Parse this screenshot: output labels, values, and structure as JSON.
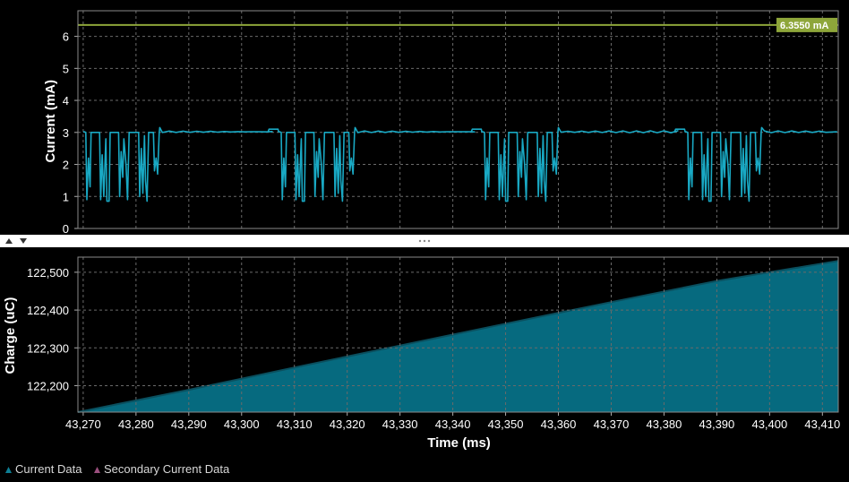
{
  "colors": {
    "background": "#000000",
    "current_series": "#19a9c4",
    "charge_fill": "#066a7f",
    "charge_edge": "#0a4f5e",
    "secondary_series": "#9b4f7e",
    "marker_line": "#8ea63a",
    "marker_badge": "#8ea63a",
    "splitter": "#ffffff",
    "grid": "#6a6a6a"
  },
  "splitter": {
    "up_arrow_icon": "triangle-up",
    "down_arrow_icon": "triangle-down",
    "grip_icon": "three-dots"
  },
  "legend": {
    "items": [
      {
        "label": "Current Data",
        "icon": "triangle-up",
        "color": "#0e7f95"
      },
      {
        "label": "Secondary Current Data",
        "icon": "triangle-up",
        "color": "#9b4f7e"
      }
    ]
  },
  "chart_data": [
    {
      "type": "line",
      "ylabel": "Current (mA)",
      "ylim": [
        0,
        6.8
      ],
      "yticks": [
        0,
        1,
        2,
        3,
        4,
        5,
        6
      ],
      "ytick_labels": [
        "0",
        "1",
        "2",
        "3",
        "4",
        "5",
        "6"
      ],
      "xlim": [
        43269,
        43413
      ],
      "grid": true,
      "marker": {
        "value": 6.355,
        "label": "6.3550 mA"
      },
      "series": [
        {
          "baseline": 3.02,
          "burst_starts": [
            43270.5,
            43307.5,
            43346,
            43384.5
          ],
          "burst_duration": 14,
          "burst_pattern": [
            [
              0.0,
              3.0
            ],
            [
              0.2,
              0.9
            ],
            [
              0.5,
              2.2
            ],
            [
              0.8,
              1.3
            ],
            [
              1.0,
              3.0
            ],
            [
              2.6,
              3.0
            ],
            [
              2.8,
              0.9
            ],
            [
              3.1,
              2.3
            ],
            [
              3.4,
              1.0
            ],
            [
              3.8,
              2.8
            ],
            [
              4.0,
              0.85
            ],
            [
              4.4,
              0.85
            ],
            [
              4.6,
              3.0
            ],
            [
              6.2,
              3.0
            ],
            [
              6.4,
              1.0
            ],
            [
              6.7,
              2.4
            ],
            [
              7.0,
              1.6
            ],
            [
              7.2,
              2.8
            ],
            [
              7.6,
              2.0
            ],
            [
              7.9,
              0.9
            ],
            [
              8.2,
              3.0
            ],
            [
              10.0,
              3.0
            ],
            [
              10.2,
              1.0
            ],
            [
              10.5,
              2.5
            ],
            [
              10.8,
              1.1
            ],
            [
              11.1,
              2.9
            ],
            [
              11.3,
              1.5
            ],
            [
              11.6,
              0.85
            ],
            [
              11.9,
              3.0
            ],
            [
              12.8,
              3.0
            ],
            [
              13.0,
              1.8
            ],
            [
              13.3,
              2.2
            ],
            [
              13.6,
              1.7
            ],
            [
              13.9,
              3.0
            ],
            [
              14.0,
              3.15
            ]
          ],
          "pre_burst_bump": 3.1
        }
      ]
    },
    {
      "type": "area",
      "ylabel": "Charge (uC)",
      "xlabel": "Time (ms)",
      "ylim": [
        122130,
        122540
      ],
      "yticks": [
        122200,
        122300,
        122400,
        122500
      ],
      "ytick_labels": [
        "122,200",
        "122,300",
        "122,400",
        "122,500"
      ],
      "xlim": [
        43269,
        43413
      ],
      "xticks": [
        43270,
        43280,
        43290,
        43300,
        43310,
        43320,
        43330,
        43340,
        43350,
        43360,
        43370,
        43380,
        43390,
        43400,
        43410
      ],
      "xtick_labels": [
        "43,270",
        "43,280",
        "43,290",
        "43,300",
        "43,310",
        "43,320",
        "43,330",
        "43,340",
        "43,350",
        "43,360",
        "43,370",
        "43,380",
        "43,390",
        "43,400",
        "43,410"
      ],
      "grid": true,
      "series": [
        {
          "x": [
            43269,
            43290,
            43310,
            43330,
            43350,
            43370,
            43390,
            43413
          ],
          "y": [
            122130,
            122189,
            122248,
            122306,
            122364,
            122421,
            122477,
            122530
          ]
        }
      ]
    }
  ]
}
